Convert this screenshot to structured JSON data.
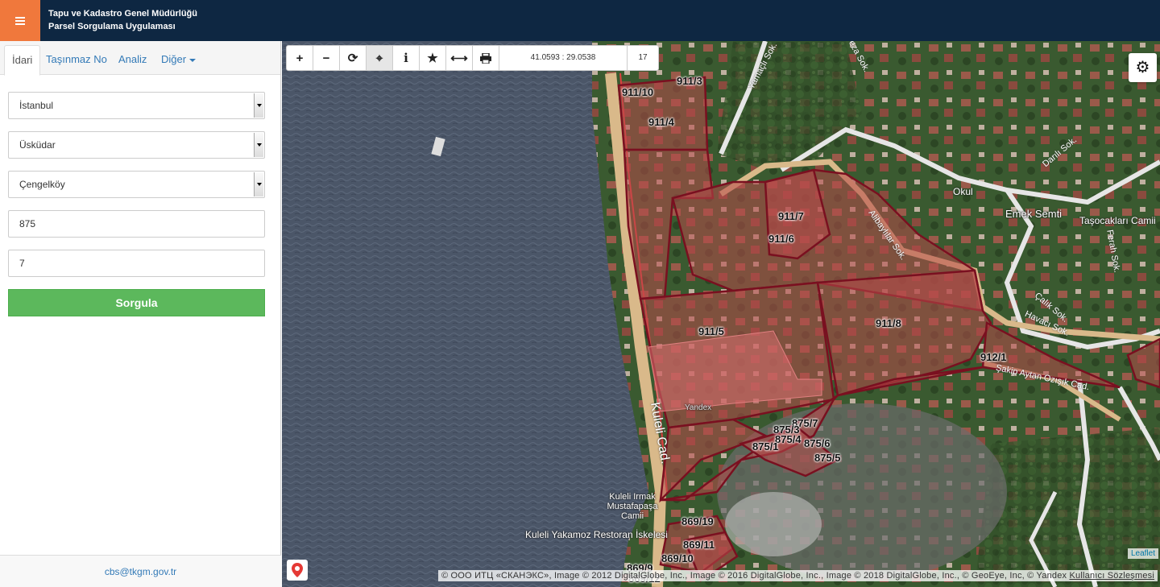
{
  "header": {
    "title_line1": "Tapu ve Kadastro Genel Müdürlüğü",
    "title_line2": "Parsel Sorgulama Uygulaması"
  },
  "tabs": [
    {
      "label": "İdari"
    },
    {
      "label": "Taşınmaz No"
    },
    {
      "label": "Analiz"
    },
    {
      "label": "Diğer"
    }
  ],
  "form": {
    "province": "İstanbul",
    "district": "Üsküdar",
    "neighborhood": "Çengelköy",
    "block": "875",
    "parcel": "7",
    "submit_label": "Sorgula"
  },
  "footer": {
    "email": "cbs@tkgm.gov.tr"
  },
  "toolbar": {
    "coordinates": "41.0593 : 29.0538",
    "zoom_level": "17",
    "tools": [
      "zoom-in",
      "zoom-out",
      "refresh",
      "locate",
      "info",
      "favorite",
      "measure",
      "print"
    ]
  },
  "map": {
    "parcels": [
      {
        "label": "911/3"
      },
      {
        "label": "911/10"
      },
      {
        "label": "911/4"
      },
      {
        "label": "911/7"
      },
      {
        "label": "911/6"
      },
      {
        "label": "911/5"
      },
      {
        "label": "911/8"
      },
      {
        "label": "912/1"
      },
      {
        "label": "875/7"
      },
      {
        "label": "875/3"
      },
      {
        "label": "875/4"
      },
      {
        "label": "875/1"
      },
      {
        "label": "875/6"
      },
      {
        "label": "875/5"
      },
      {
        "label": "869/19"
      },
      {
        "label": "869/11"
      },
      {
        "label": "869/10"
      },
      {
        "label": "869/9"
      },
      {
        "label": "869/12"
      }
    ],
    "streets": [
      {
        "label": "Yamaçlı Sok."
      },
      {
        "label": "Feza Sok."
      },
      {
        "label": "Darılı Sok."
      },
      {
        "label": "Alibaylılar Sok."
      },
      {
        "label": "Çalık Sok."
      },
      {
        "label": "Havacı Sok."
      },
      {
        "label": "Şakip Aytan Ozışık Cad."
      },
      {
        "label": "Kuleli Cad."
      },
      {
        "label": "Ferah Sok."
      }
    ],
    "places": [
      {
        "label": "Okul"
      },
      {
        "label": "Emek Semti"
      },
      {
        "label": "Taşocakları Camii"
      },
      {
        "label": "Kuleli Irmak Mustafapaşa Camii"
      },
      {
        "label": "Kuleli Yakamoz Restoran İskelesi"
      },
      {
        "label": "Yandex"
      }
    ],
    "attribution_text": "© ООО ИТЦ «СКАНЭКС», Image © 2012 DigitalGlobe, Inc., Image © 2016 DigitalGlobe, Inc., Image © 2018 DigitalGlobe, Inc., © GeoEye, Inc, © Yandex ",
    "attribution_link": "Kullanıcı Sözleşmesi",
    "leaflet_label": "Leaflet"
  },
  "colors": {
    "header_bg": "#0e2742",
    "menu_button": "#f0783c",
    "submit_button": "#5cb85c",
    "parcel_fill": "#b84a4a",
    "parcel_border": "#7a1020"
  }
}
